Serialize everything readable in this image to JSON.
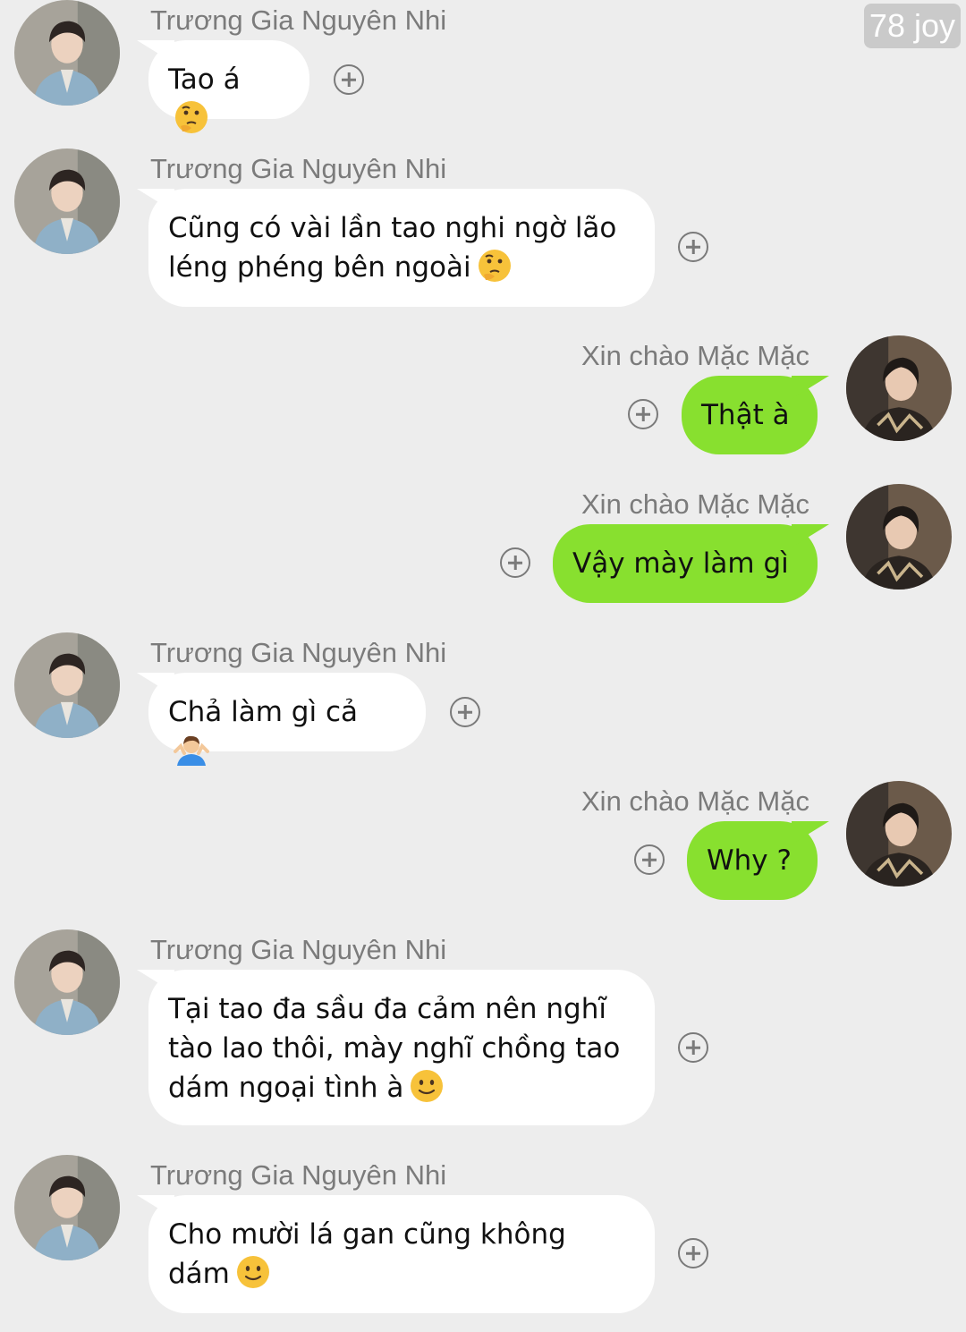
{
  "watermark": "78 joy",
  "contacts": {
    "incoming_name": "Trương Gia Nguyên Nhi",
    "outgoing_name": "Xin chào Mặc Mặc"
  },
  "messages": [
    {
      "direction": "in",
      "sender": "Trương Gia Nguyên Nhi",
      "lines": [
        "Tao á"
      ],
      "emoji": "thinking-face"
    },
    {
      "direction": "in",
      "sender": "Trương Gia Nguyên Nhi",
      "lines": [
        "Cũng có vài lần tao nghi ngờ lão",
        "léng phéng bên ngoài"
      ],
      "emoji": "thinking-face"
    },
    {
      "direction": "out",
      "sender": "Xin chào Mặc Mặc",
      "lines": [
        "Thật à"
      ],
      "emoji": ""
    },
    {
      "direction": "out",
      "sender": "Xin chào Mặc Mặc",
      "lines": [
        "Vậy mày làm gì"
      ],
      "emoji": ""
    },
    {
      "direction": "in",
      "sender": "Trương Gia Nguyên Nhi",
      "lines": [
        "Chả làm gì cả"
      ],
      "emoji": "person-shrugging"
    },
    {
      "direction": "out",
      "sender": "Xin chào Mặc Mặc",
      "lines": [
        "Why ?"
      ],
      "emoji": ""
    },
    {
      "direction": "in",
      "sender": "Trương Gia Nguyên Nhi",
      "lines": [
        "Tại tao đa sầu đa cảm nên nghĩ",
        "tào lao thôi, mày nghĩ chồng tao",
        "dám ngoại tình à"
      ],
      "emoji": "slightly-smiling-face"
    },
    {
      "direction": "in",
      "sender": "Trương Gia Nguyên Nhi",
      "lines": [
        "Cho mười lá gan cũng không",
        "dám"
      ],
      "emoji": "slightly-smiling-face"
    }
  ],
  "icons": {
    "reaction": "plus-circle-icon",
    "avatar_incoming": "avatar-girl-blue-jacket",
    "avatar_outgoing": "avatar-boy-dark-shirt"
  },
  "colors": {
    "background": "#ededed",
    "incoming_bubble": "#ffffff",
    "outgoing_bubble": "#88e02f",
    "sender_text": "#7b7b7b"
  }
}
